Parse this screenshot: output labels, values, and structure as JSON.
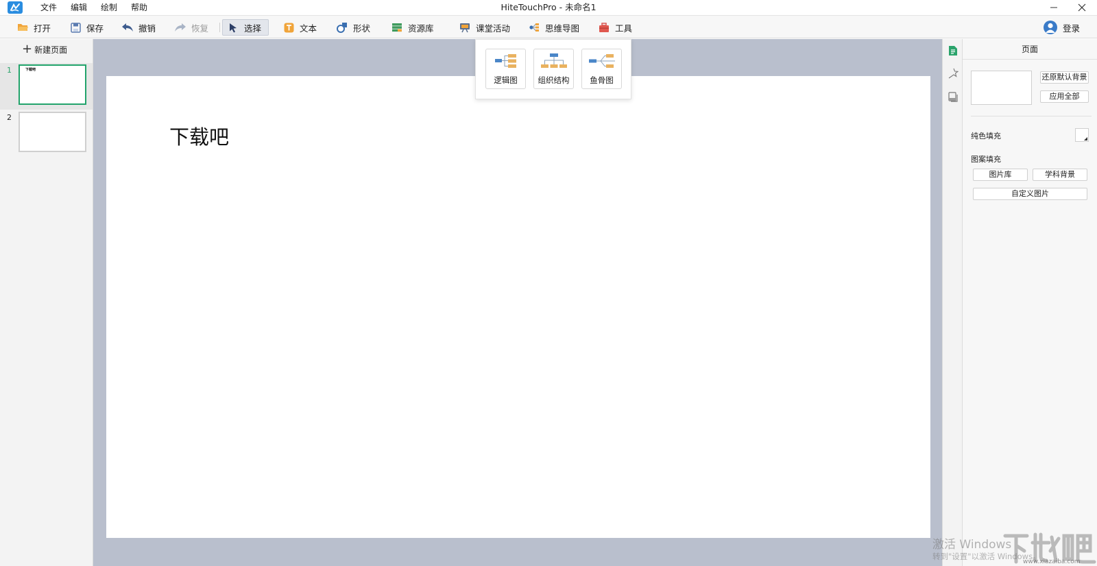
{
  "window": {
    "title": "HiteTouchPro - 未命名1"
  },
  "menu": [
    "文件",
    "编辑",
    "绘制",
    "帮助"
  ],
  "toolbar": {
    "open": "打开",
    "save": "保存",
    "undo": "撤销",
    "redo": "恢复",
    "select": "选择",
    "text": "文本",
    "shape": "形状",
    "resources": "资源库",
    "classroom": "课堂活动",
    "mindmap": "思维导图",
    "tools": "工具",
    "login": "登录"
  },
  "pages_panel": {
    "new_page": "新建页面",
    "pages": [
      {
        "number": "1",
        "preview_text": "下载吧",
        "selected": true
      },
      {
        "number": "2",
        "preview_text": "",
        "selected": false
      }
    ]
  },
  "canvas": {
    "text": "下载吧"
  },
  "mindmap_menu": {
    "items": [
      "逻辑图",
      "组织结构",
      "鱼骨图"
    ]
  },
  "right_panel": {
    "title": "页面",
    "restore_bg": "还原默认背景",
    "apply_all": "应用全部",
    "solid_fill": "纯色填充",
    "pattern_fill": "图案填充",
    "image_library": "图片库",
    "subject_bg": "学科背景",
    "custom_image": "自定义图片"
  },
  "watermark": {
    "activate_line1": "激活 Windows",
    "activate_line2": "转到\"设置\"以激活 Windows。",
    "site_url": "www.xiazaiba.com"
  },
  "colors": {
    "accent_green": "#22a36b",
    "workspace_bg": "#b9bfcd",
    "toolbar_bg": "#f7f7f7"
  }
}
